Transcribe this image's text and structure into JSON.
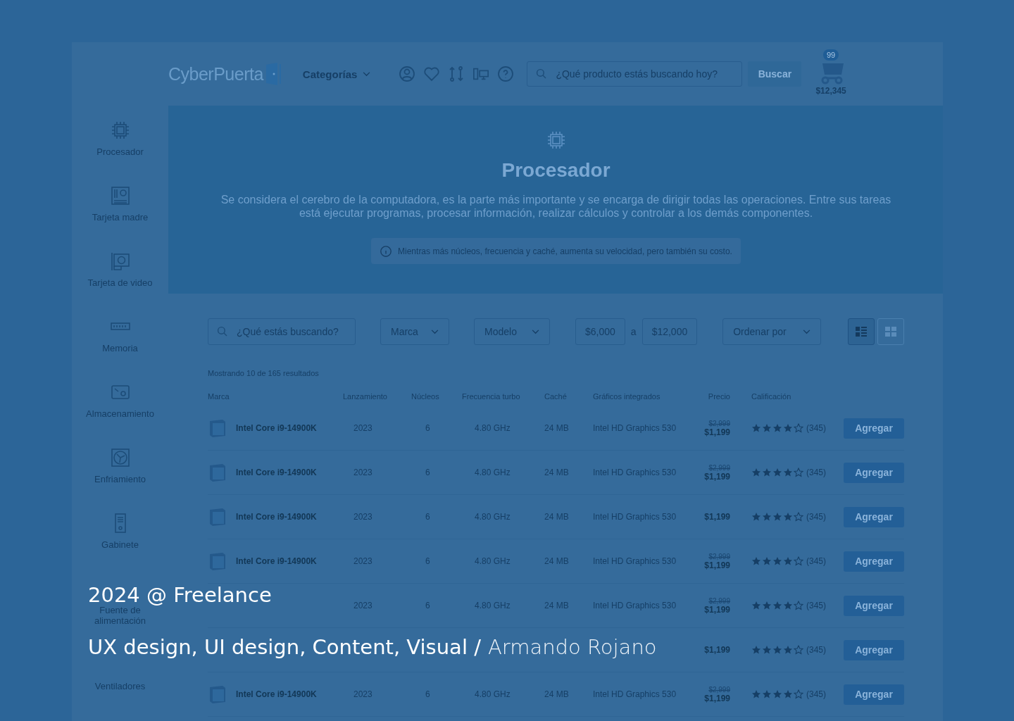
{
  "header": {
    "logo": "CyberPuerta",
    "categories": "Categorías",
    "search": {
      "placeholder": "¿Qué producto estás buscando hoy?"
    },
    "search_button": "Buscar",
    "cart": {
      "badge": "99",
      "total": "$12,345"
    }
  },
  "sidebar": {
    "items": [
      {
        "label": "Procesador",
        "kind": "chip"
      },
      {
        "label": "Tarjeta madre",
        "kind": "board"
      },
      {
        "label": "Tarjeta de video",
        "kind": "gpu"
      },
      {
        "label": "Memoria",
        "kind": "ram"
      },
      {
        "label": "Almacenamiento",
        "kind": "disk"
      },
      {
        "label": "Enfriamiento",
        "kind": "fan"
      },
      {
        "label": "Gabinete",
        "kind": "case"
      },
      {
        "label": "Fuente de alimentación"
      },
      {
        "label": "Ventiladores"
      }
    ]
  },
  "hero": {
    "title": "Procesador",
    "description": "Se considera el cerebro de la computadora, es la parte más importante y se encarga de dirigir todas las operaciones. Entre sus tareas está ejecutar programas, procesar información, realizar cálculos y controlar a los demás componentes.",
    "note": "Mientras más núcleos, frecuencia y caché, aumenta su velocidad, pero también su costo."
  },
  "filters": {
    "search": {
      "placeholder": "¿Qué estás buscando?"
    },
    "brand": "Marca",
    "model": "Modelo",
    "price_min": "$6,000",
    "price_sep": "a",
    "price_max": "$12,000",
    "sort": "Ordenar por",
    "views": [
      {
        "kind": "list",
        "selected": true
      },
      {
        "kind": "grid",
        "selected": false
      }
    ]
  },
  "results_count": "Mostrando 10 de 165 resultados",
  "table": {
    "columns": [
      "Marca",
      "Lanzamiento",
      "Núcleos",
      "Frecuencia turbo",
      "Caché",
      "Gráficos integrados",
      "Precio",
      "Calificación"
    ],
    "rows": [
      {
        "name": "Intel Core i9-14900K",
        "year": "2023",
        "cores": "6",
        "freq": "4.80 GHz",
        "cache": "24 MB",
        "graphics": "Intel HD Graphics 530",
        "old_price": "$2,999",
        "price": "$1,199",
        "stars": 4,
        "reviews": "(345)",
        "button": "Agregar"
      },
      {
        "name": "Intel Core i9-14900K",
        "year": "2023",
        "cores": "6",
        "freq": "4.80 GHz",
        "cache": "24 MB",
        "graphics": "Intel HD Graphics 530",
        "old_price": "$2,999",
        "price": "$1,199",
        "stars": 4,
        "reviews": "(345)",
        "button": "Agregar"
      },
      {
        "name": "Intel Core i9-14900K",
        "year": "2023",
        "cores": "6",
        "freq": "4.80 GHz",
        "cache": "24 MB",
        "graphics": "Intel HD Graphics 530",
        "price": "$1,199",
        "stars": 4,
        "reviews": "(345)",
        "button": "Agregar"
      },
      {
        "name": "Intel Core i9-14900K",
        "year": "2023",
        "cores": "6",
        "freq": "4.80 GHz",
        "cache": "24 MB",
        "graphics": "Intel HD Graphics 530",
        "old_price": "$2,999",
        "price": "$1,199",
        "stars": 4,
        "reviews": "(345)",
        "button": "Agregar"
      },
      {
        "year": "2023",
        "cores": "6",
        "freq": "4.80 GHz",
        "cache": "24 MB",
        "graphics": "Intel HD Graphics 530",
        "old_price": "$2,999",
        "price": "$1,199",
        "stars": 4,
        "reviews": "(345)",
        "button": "Agregar"
      },
      {
        "price": "$1,199",
        "stars": 4,
        "reviews": "(345)",
        "button": "Agregar"
      },
      {
        "name": "Intel Core i9-14900K",
        "year": "2023",
        "cores": "6",
        "freq": "4.80 GHz",
        "cache": "24 MB",
        "graphics": "Intel HD Graphics 530",
        "old_price": "$2,999",
        "price": "$1,199",
        "stars": 4,
        "reviews": "(345)",
        "button": "Agregar"
      }
    ]
  },
  "caption": {
    "title": "2024 @ Freelance",
    "roles": "UX design, UI design, Content, Visual /",
    "author": "Armando Rojano"
  }
}
